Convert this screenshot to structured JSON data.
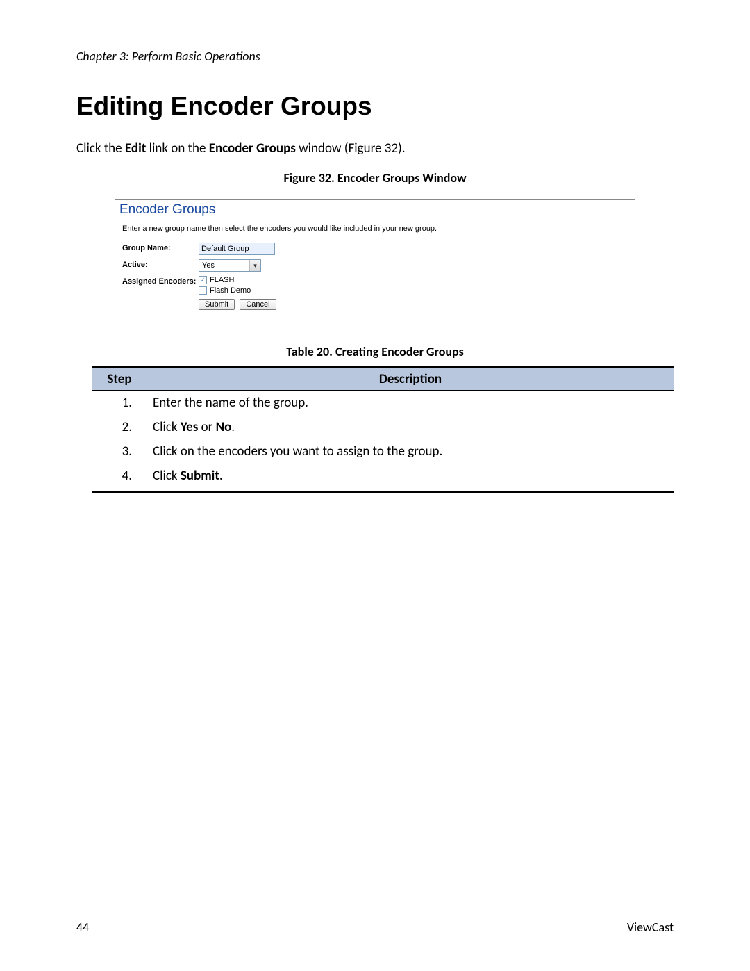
{
  "header": {
    "chapter": "Chapter 3: Perform Basic Operations"
  },
  "title": "Editing Encoder Groups",
  "intro": {
    "pre": "Click the ",
    "bold1": "Edit",
    "mid": " link on the ",
    "bold2": "Encoder Groups",
    "post": " window (Figure 32)."
  },
  "figure_caption": "Figure 32. Encoder Groups Window",
  "screenshot": {
    "title": "Encoder Groups",
    "instruction": "Enter a new group name then select the encoders you would like included in your new group.",
    "rows": {
      "group_name_label": "Group Name:",
      "group_name_value": "Default Group",
      "active_label": "Active:",
      "active_value": "Yes",
      "assigned_label": "Assigned Encoders:",
      "encoders": [
        {
          "label": "FLASH",
          "checked": true
        },
        {
          "label": "Flash Demo",
          "checked": false
        }
      ],
      "submit": "Submit",
      "cancel": "Cancel"
    }
  },
  "table_caption": "Table 20. Creating Encoder Groups",
  "table": {
    "headers": {
      "step": "Step",
      "desc": "Description"
    },
    "rows": [
      {
        "n": "1.",
        "pre": "Enter the name of the group.",
        "b1": "",
        "mid": "",
        "b2": "",
        "post": ""
      },
      {
        "n": "2.",
        "pre": "Click ",
        "b1": "Yes",
        "mid": " or ",
        "b2": "No",
        "post": "."
      },
      {
        "n": "3.",
        "pre": "Click on the encoders you want to assign to the group.",
        "b1": "",
        "mid": "",
        "b2": "",
        "post": ""
      },
      {
        "n": "4.",
        "pre": "Click ",
        "b1": "Submit",
        "mid": "",
        "b2": "",
        "post": "."
      }
    ]
  },
  "footer": {
    "page": "44",
    "brand": "ViewCast"
  }
}
